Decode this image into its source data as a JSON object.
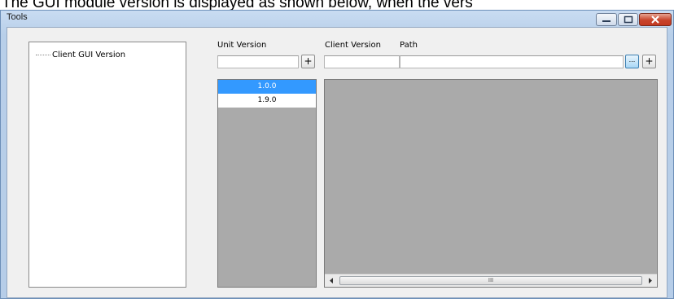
{
  "caption_text": "The GUI module version is displayed as shown below, when the vers",
  "window": {
    "title": "Tools"
  },
  "tree": {
    "items": [
      {
        "label": "Client GUI Version"
      }
    ]
  },
  "labels": {
    "unit_version": "Unit Version",
    "client_version": "Client Version",
    "path": "Path"
  },
  "inputs": {
    "unit_version": "",
    "client_version": "",
    "path": ""
  },
  "buttons": {
    "add_unit": "+",
    "browse": "...",
    "add_client": "+"
  },
  "unit_versions": [
    {
      "label": "1.0.0",
      "selected": true
    },
    {
      "label": "1.9.0",
      "selected": false
    }
  ],
  "scrollbar": {
    "thumb_grip": "III"
  },
  "colors": {
    "selection": "#3399ff",
    "grid_background": "#aaaaaa",
    "title_bar": "#c9dcf2"
  }
}
